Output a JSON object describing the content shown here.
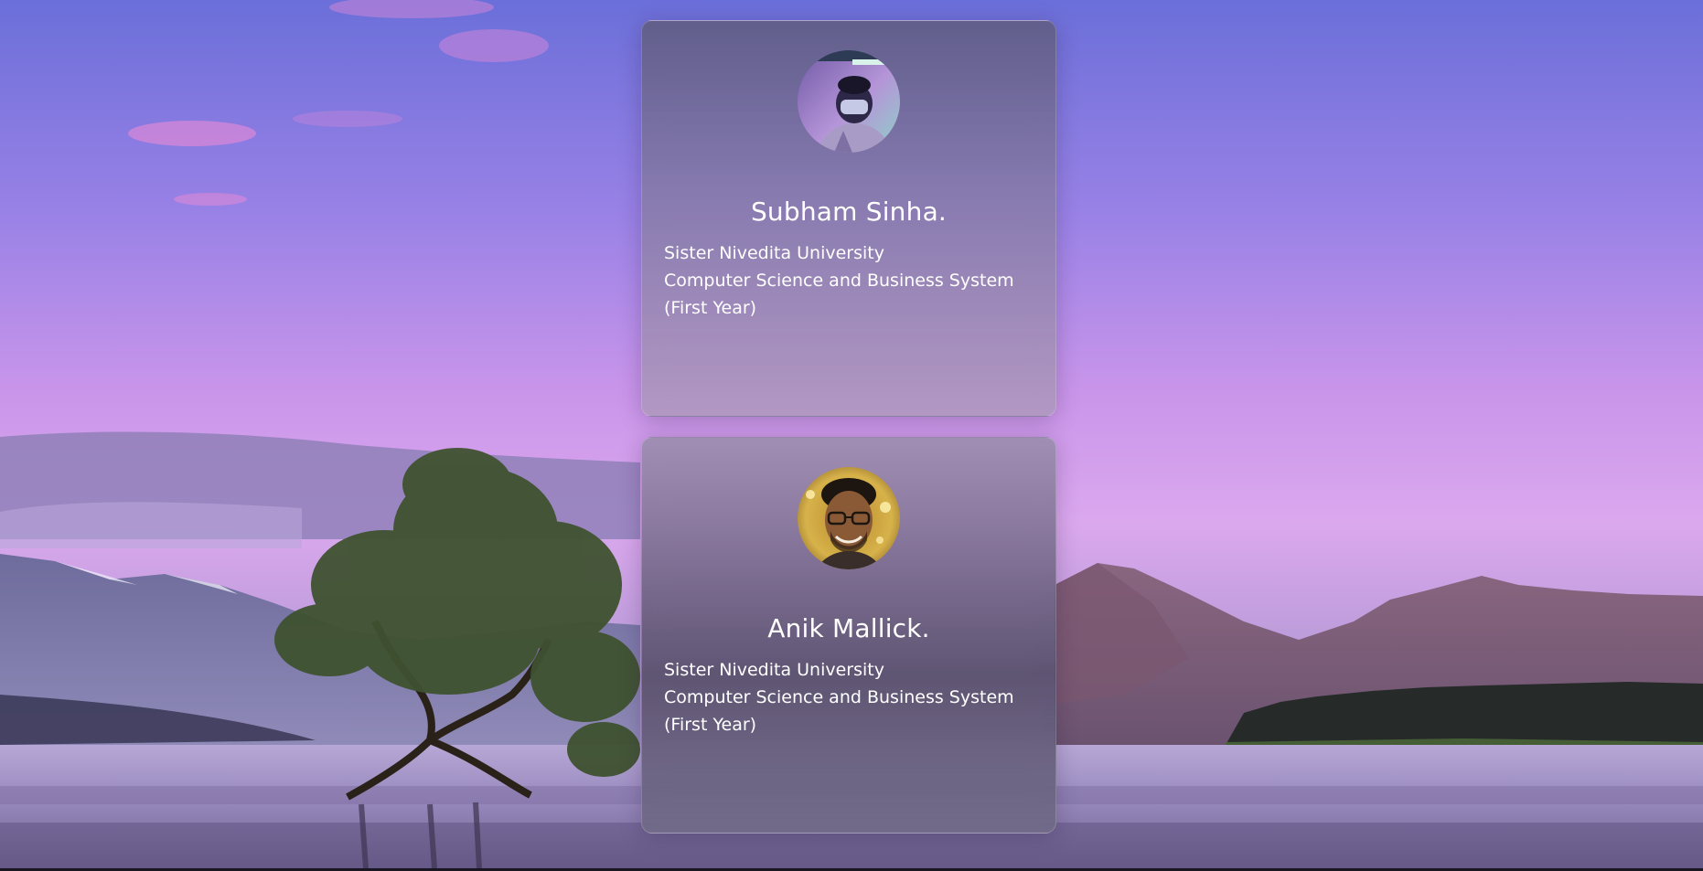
{
  "profiles": [
    {
      "name": "Subham Sinha.",
      "university": "Sister Nivedita University",
      "department": "Computer Science and Business System",
      "year": "(First Year)",
      "avatar_icon": "person-masked-photo"
    },
    {
      "name": "Anik Mallick.",
      "university": "Sister Nivedita University",
      "department": "Computer Science and Business System",
      "year": "(First Year)",
      "avatar_icon": "person-glasses-photo"
    }
  ],
  "colors": {
    "sky_top": "#6b6fd9",
    "sky_mid": "#b98ae6",
    "sky_horizon": "#d8a6ee",
    "water": "#8d7fb0",
    "text": "#ffffff"
  }
}
